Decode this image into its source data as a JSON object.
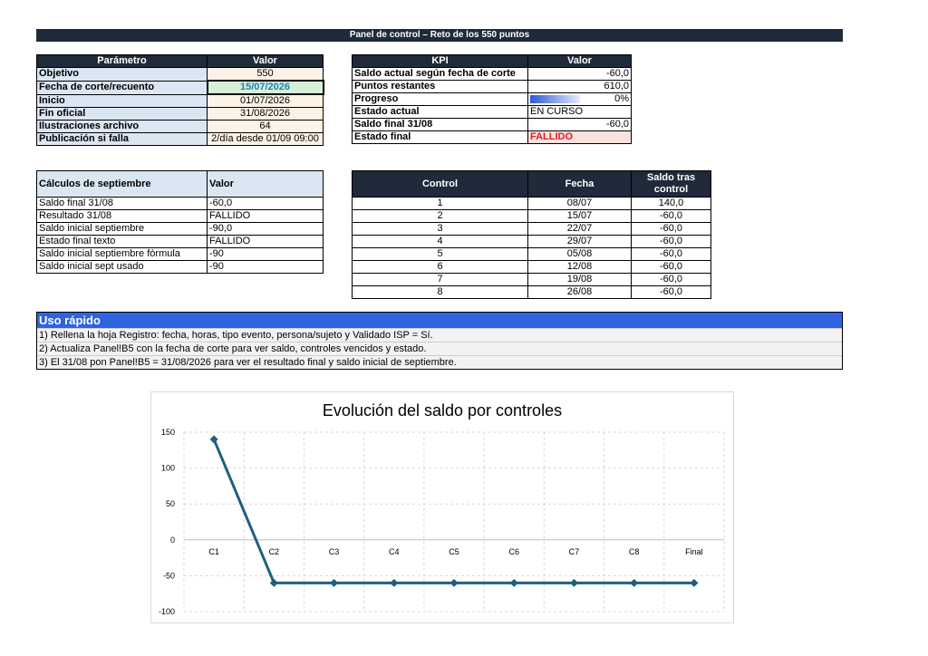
{
  "header": {
    "title": "Panel de control – Reto de los 550 puntos"
  },
  "param_table": {
    "headers": [
      "Parámetro",
      "Valor"
    ],
    "rows": [
      {
        "label": "Objetivo",
        "value": "550"
      },
      {
        "label": "Fecha de corte/recuento",
        "value": "15/07/2026"
      },
      {
        "label": "Inicio",
        "value": "01/07/2026"
      },
      {
        "label": "Fin oficial",
        "value": "31/08/2026"
      },
      {
        "label": "Ilustraciones archivo",
        "value": "64"
      },
      {
        "label": "Publicación si falla",
        "value": "2/día desde 01/09 09:00"
      }
    ]
  },
  "kpi_table": {
    "headers": [
      "KPI",
      "Valor"
    ],
    "rows": [
      {
        "label": "Saldo actual según fecha de corte",
        "value": "-60,0"
      },
      {
        "label": "Puntos restantes",
        "value": "610,0"
      },
      {
        "label": "Progreso",
        "value": "0%"
      },
      {
        "label": "Estado actual",
        "value": "EN CURSO"
      },
      {
        "label": "Saldo final 31/08",
        "value": "-60,0"
      },
      {
        "label": "Estado final",
        "value": "FALLIDO"
      }
    ],
    "progress_fraction": 0.0
  },
  "sept_table": {
    "headers": [
      "Cálculos de septiembre",
      "Valor"
    ],
    "rows": [
      {
        "label": "Saldo final 31/08",
        "value": "-60,0"
      },
      {
        "label": "Resultado 31/08",
        "value": "FALLIDO"
      },
      {
        "label": "Saldo inicial septiembre",
        "value": "-90,0"
      },
      {
        "label": "Estado final texto",
        "value": "FALLIDO"
      },
      {
        "label": "Saldo inicial septiembre fórmula",
        "value": "-90"
      },
      {
        "label": "Saldo inicial sept usado",
        "value": "-90"
      }
    ]
  },
  "ctrl_table": {
    "headers": [
      "Control",
      "Fecha",
      "Saldo tras control"
    ],
    "rows": [
      {
        "control": "1",
        "fecha": "08/07",
        "saldo": "140,0"
      },
      {
        "control": "2",
        "fecha": "15/07",
        "saldo": "-60,0"
      },
      {
        "control": "3",
        "fecha": "22/07",
        "saldo": "-60,0"
      },
      {
        "control": "4",
        "fecha": "29/07",
        "saldo": "-60,0"
      },
      {
        "control": "5",
        "fecha": "05/08",
        "saldo": "-60,0"
      },
      {
        "control": "6",
        "fecha": "12/08",
        "saldo": "-60,0"
      },
      {
        "control": "7",
        "fecha": "19/08",
        "saldo": "-60,0"
      },
      {
        "control": "8",
        "fecha": "26/08",
        "saldo": "-60,0"
      }
    ]
  },
  "uso_rapido": {
    "title": "Uso rápido",
    "lines": [
      "1) Rellena la hoja Registro: fecha, horas, tipo evento, persona/sujeto y Validado ISP = Sí.",
      "2) Actualiza Panel!B5 con la fecha de corte para ver saldo, controles vencidos y estado.",
      "3) El 31/08 pon Panel!B5 = 31/08/2026 para ver el resultado final y saldo inicial de septiembre."
    ]
  },
  "colors": {
    "header_dark": "#1f2a3a",
    "accent_blue": "#2f63e0",
    "line_series": "#1f5f80",
    "fail_red": "#e02020"
  },
  "chart_data": {
    "type": "line",
    "title": "Evolución del saldo por controles",
    "categories": [
      "C1",
      "C2",
      "C3",
      "C4",
      "C5",
      "C6",
      "C7",
      "C8",
      "Final"
    ],
    "series": [
      {
        "values": [
          140,
          -60,
          -60,
          -60,
          -60,
          -60,
          -60,
          -60,
          -60
        ]
      }
    ],
    "ylim": [
      -100,
      150
    ],
    "yticks": [
      150,
      100,
      50,
      0,
      -50,
      -100
    ],
    "grid": true,
    "legend": "none"
  }
}
